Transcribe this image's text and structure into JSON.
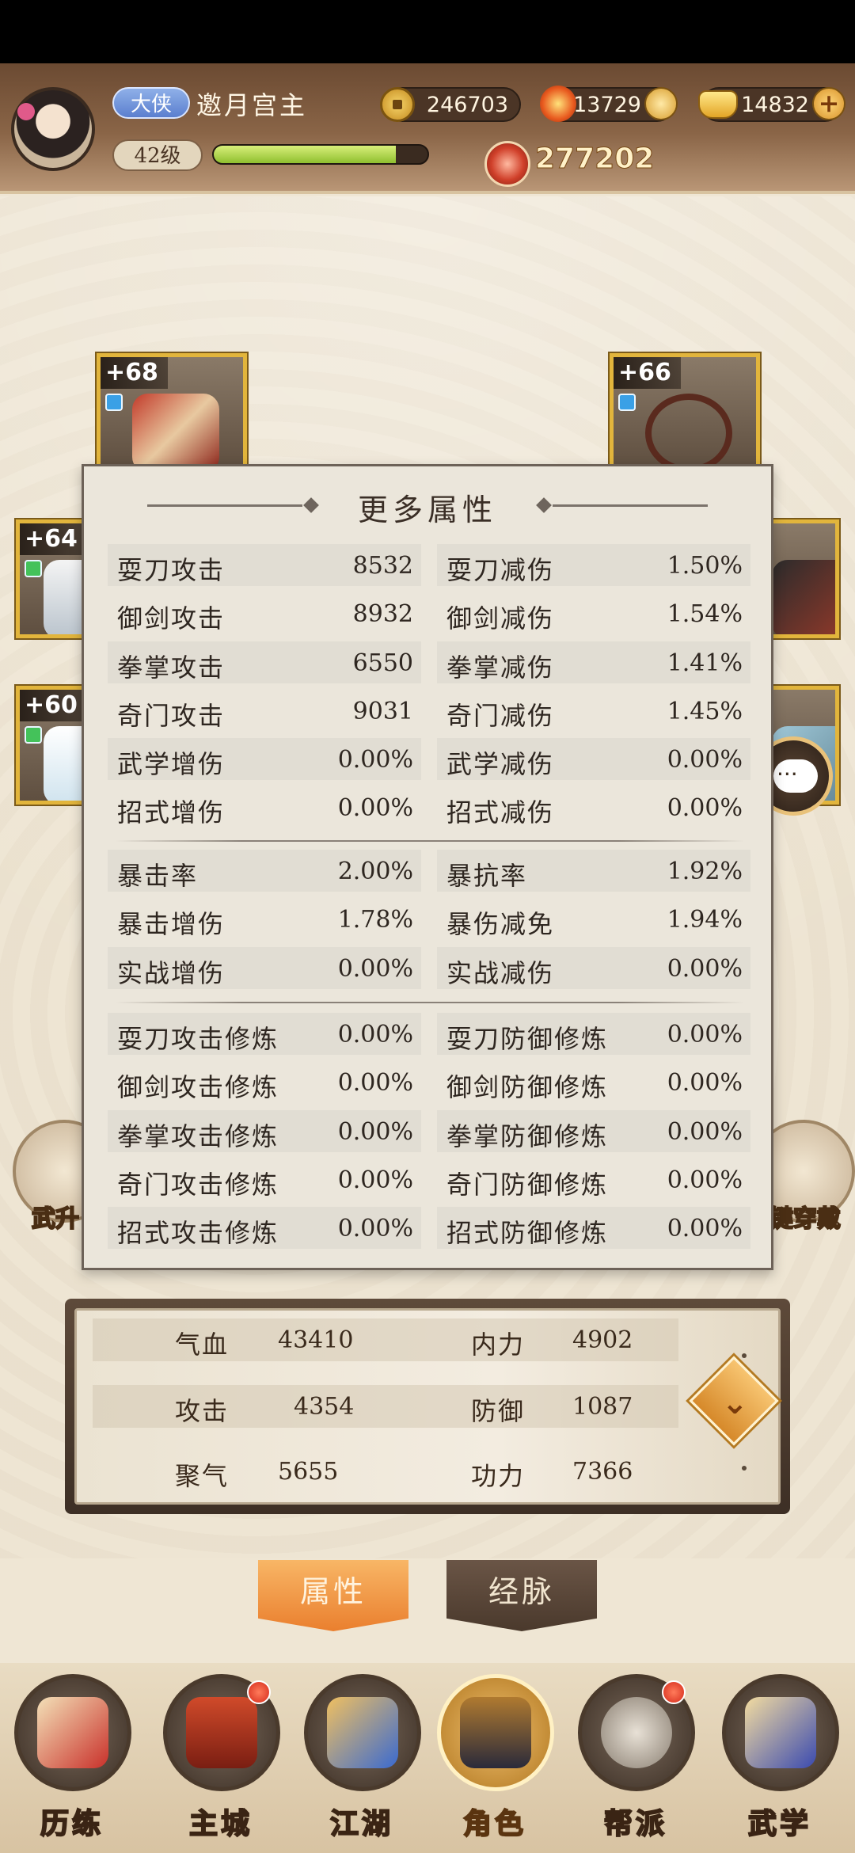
{
  "header": {
    "rank": "大侠",
    "name": "邀月宫主",
    "level": "42级",
    "xp_fraction": 0.85,
    "coins": "246703",
    "flame": "13729",
    "ingots": "14832",
    "power": "277202",
    "icons": [
      "avatar",
      "coin-icon",
      "flame-icon",
      "mini-coin-icon",
      "ingot-icon",
      "plus-icon",
      "power-icon"
    ]
  },
  "equipment": [
    {
      "level": "+68",
      "gem": "blue"
    },
    {
      "level": "+66",
      "gem": "blue"
    },
    {
      "level": "+64",
      "gem": "green"
    },
    {
      "level": "+60",
      "gem": "green"
    }
  ],
  "side_buttons": {
    "left_label": "武升",
    "right_label": "键穿戴"
  },
  "panel": {
    "title": "更多属性",
    "attack_group": [
      {
        "left_k": "耍刀攻击",
        "left_v": "8532",
        "right_k": "耍刀减伤",
        "right_v": "1.50%"
      },
      {
        "left_k": "御剑攻击",
        "left_v": "8932",
        "right_k": "御剑减伤",
        "right_v": "1.54%"
      },
      {
        "left_k": "拳掌攻击",
        "left_v": "6550",
        "right_k": "拳掌减伤",
        "right_v": "1.41%"
      },
      {
        "left_k": "奇门攻击",
        "left_v": "9031",
        "right_k": "奇门减伤",
        "right_v": "1.45%"
      },
      {
        "left_k": "武学增伤",
        "left_v": "0.00%",
        "right_k": "武学减伤",
        "right_v": "0.00%"
      },
      {
        "left_k": "招式增伤",
        "left_v": "0.00%",
        "right_k": "招式减伤",
        "right_v": "0.00%"
      }
    ],
    "crit_group": [
      {
        "left_k": "暴击率",
        "left_v": "2.00%",
        "right_k": "暴抗率",
        "right_v": "1.92%"
      },
      {
        "left_k": "暴击增伤",
        "left_v": "1.78%",
        "right_k": "暴伤减免",
        "right_v": "1.94%"
      },
      {
        "left_k": "实战增伤",
        "left_v": "0.00%",
        "right_k": "实战减伤",
        "right_v": "0.00%"
      }
    ],
    "training_group": [
      {
        "left_k": "耍刀攻击修炼",
        "left_v": "0.00%",
        "right_k": "耍刀防御修炼",
        "right_v": "0.00%"
      },
      {
        "left_k": "御剑攻击修炼",
        "left_v": "0.00%",
        "right_k": "御剑防御修炼",
        "right_v": "0.00%"
      },
      {
        "left_k": "拳掌攻击修炼",
        "left_v": "0.00%",
        "right_k": "拳掌防御修炼",
        "right_v": "0.00%"
      },
      {
        "left_k": "奇门攻击修炼",
        "left_v": "0.00%",
        "right_k": "奇门防御修炼",
        "right_v": "0.00%"
      },
      {
        "left_k": "招式攻击修炼",
        "left_v": "0.00%",
        "right_k": "招式防御修炼",
        "right_v": "0.00%"
      }
    ]
  },
  "base_stats": {
    "hp_k": "气血",
    "hp_v": "43410",
    "mp_k": "内力",
    "mp_v": "4902",
    "atk_k": "攻击",
    "atk_v": "4354",
    "def_k": "防御",
    "def_v": "1087",
    "qi_k": "聚气",
    "qi_v": "5655",
    "gong_k": "功力",
    "gong_v": "7366"
  },
  "tabs": {
    "attributes": "属性",
    "meridians": "经脉"
  },
  "nav": [
    {
      "label": "历练",
      "badge": false
    },
    {
      "label": "主城",
      "badge": true
    },
    {
      "label": "江湖",
      "badge": false
    },
    {
      "label": "角色",
      "badge": false,
      "active": true
    },
    {
      "label": "帮派",
      "badge": true
    },
    {
      "label": "武学",
      "badge": false
    }
  ]
}
